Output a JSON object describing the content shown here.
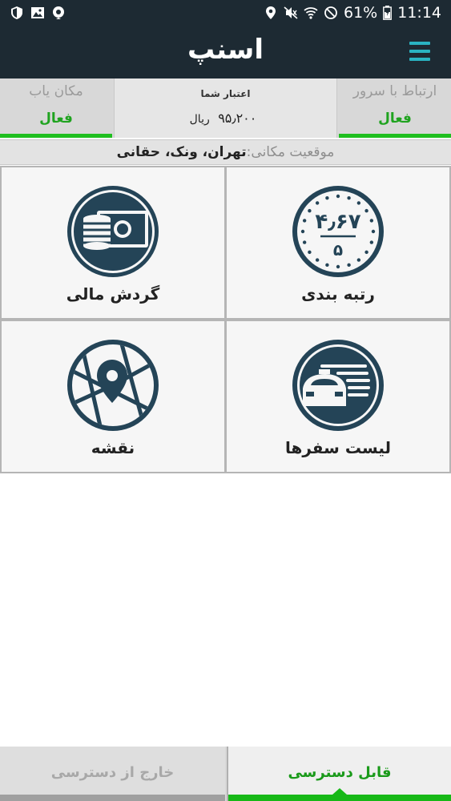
{
  "status_bar": {
    "battery": "61%",
    "time": "11:14",
    "icons": [
      "shield-icon",
      "gallery-icon",
      "location-pin-icon",
      "location-icon",
      "mute-icon",
      "wifi-icon",
      "do-not-disturb-icon",
      "battery-icon"
    ]
  },
  "app_bar": {
    "logo": "اسنپ",
    "menu_icon": "hamburger-menu-icon",
    "accent": "#2ab3c2",
    "background": "#1d2a33"
  },
  "status_row": {
    "gps": {
      "label": "مکان یاب",
      "value": "فعال"
    },
    "credit": {
      "title": "اعتبار شما",
      "amount": "۹۵٫۲۰۰",
      "unit": "ریال"
    },
    "server": {
      "label": "ارتباط با سرور",
      "value": "فعال"
    },
    "active_color": "#1fa31f"
  },
  "location": {
    "label": "موقعیت مکانی:",
    "value": "تهران، ونک، حقانی"
  },
  "tiles": {
    "rating": {
      "label": "رتبه بندی",
      "score": "۴٫۶۷",
      "max": "۵",
      "icon": "rating-badge-icon"
    },
    "finance": {
      "label": "گردش مالی",
      "icon": "money-coins-icon"
    },
    "trips": {
      "label": "لیست سفرها",
      "icon": "taxi-list-icon"
    },
    "map": {
      "label": "نقشه",
      "icon": "map-pin-icon"
    }
  },
  "bottom_tabs": {
    "available": "قابل دسترسی",
    "unavailable": "خارج از دسترسی",
    "active_color": "#17b817"
  }
}
